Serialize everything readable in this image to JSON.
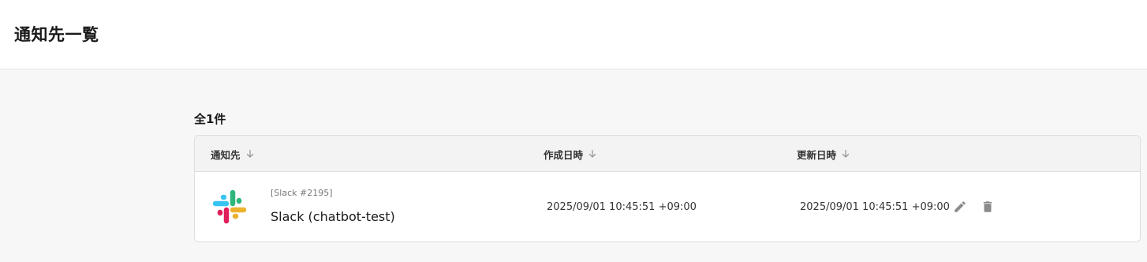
{
  "header": {
    "title": "通知先一覧"
  },
  "list": {
    "count_label": "全1件",
    "columns": {
      "destination": "通知先",
      "created_at": "作成日時",
      "updated_at": "更新日時"
    },
    "rows": [
      {
        "service_label": "[Slack #2195]",
        "name": "Slack (chatbot-test)",
        "created_at": "2025/09/01 10:45:51 +09:00",
        "updated_at": "2025/09/01 10:45:51 +09:00",
        "icon": "slack-logo"
      }
    ]
  },
  "icons": {
    "sort": "arrow-down-icon",
    "edit": "pencil-icon",
    "delete": "trash-icon"
  },
  "colors": {
    "slack_blue": "#36C5F0",
    "slack_green": "#2EB67D",
    "slack_yellow": "#ECB22E",
    "slack_red": "#E01E5A",
    "action_icon": "#8a8a8a"
  }
}
